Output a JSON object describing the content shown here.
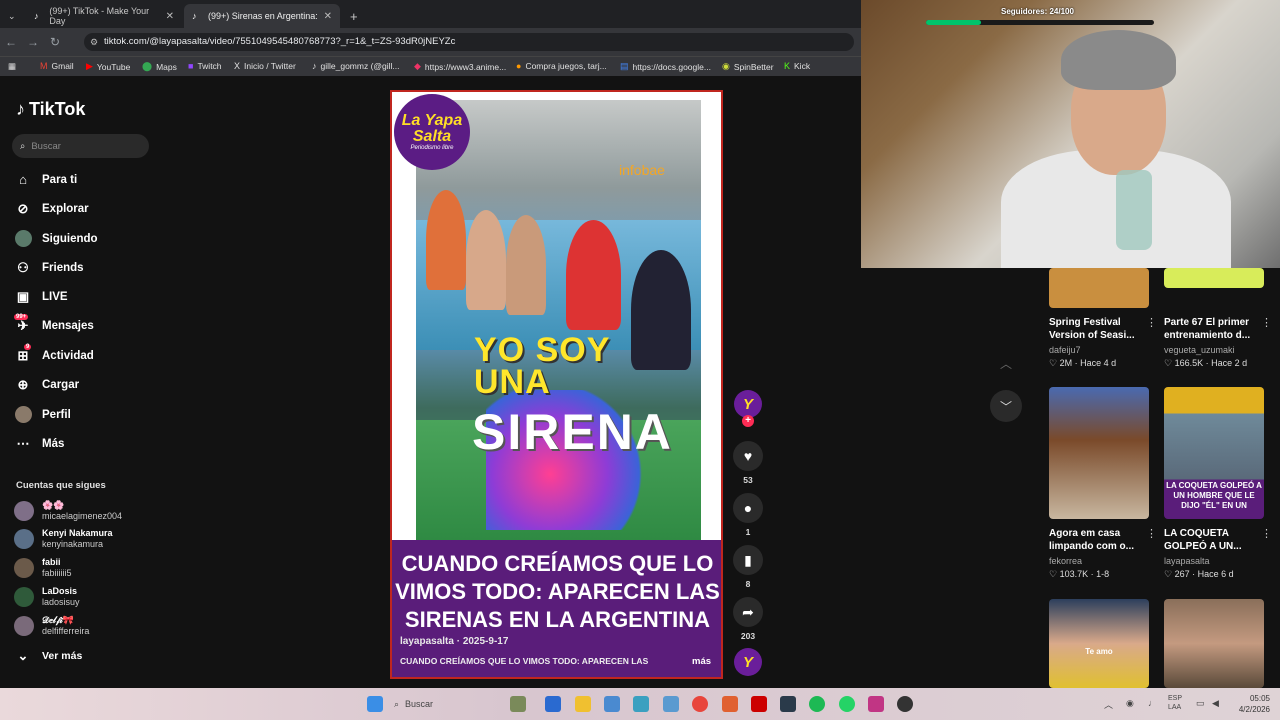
{
  "browser": {
    "tabs": [
      {
        "label": "(99+) TikTok - Make Your Day",
        "active": false
      },
      {
        "label": "(99+) Sirenas en Argentina: Un ...",
        "active": true
      }
    ],
    "new_tab": "+",
    "url": "tiktok.com/@layapasalta/video/7551049545480768773?_r=1&_t=ZS-93dR0jNEYZc",
    "bookmarks": [
      {
        "label": "Gmail",
        "icon": "gmail-icon"
      },
      {
        "label": "YouTube",
        "icon": "youtube-icon"
      },
      {
        "label": "Maps",
        "icon": "maps-icon"
      },
      {
        "label": "Twitch",
        "icon": "twitch-icon"
      },
      {
        "label": "Inicio / Twitter",
        "icon": "x-icon"
      },
      {
        "label": "gille_gommz (@gill...",
        "icon": "tiktok-icon"
      },
      {
        "label": "https://www3.anime...",
        "icon": "anime-icon"
      },
      {
        "label": "Compra juegos, tarj...",
        "icon": "store-icon"
      },
      {
        "label": "https://docs.google...",
        "icon": "docs-icon"
      },
      {
        "label": "SpinBetter",
        "icon": "spin-icon"
      },
      {
        "label": "Kick",
        "icon": "kick-icon"
      }
    ]
  },
  "sidebar": {
    "brand": "TikTok",
    "search_placeholder": "Buscar",
    "nav": [
      {
        "label": "Para ti",
        "icon": "home-icon"
      },
      {
        "label": "Explorar",
        "icon": "compass-icon"
      },
      {
        "label": "Siguiendo",
        "icon": "following-avatar-icon"
      },
      {
        "label": "Friends",
        "icon": "friends-icon"
      },
      {
        "label": "LIVE",
        "icon": "live-icon"
      },
      {
        "label": "Mensajes",
        "icon": "messages-icon",
        "badge": "99+"
      },
      {
        "label": "Actividad",
        "icon": "activity-icon",
        "badge": "9"
      },
      {
        "label": "Cargar",
        "icon": "upload-icon"
      },
      {
        "label": "Perfil",
        "icon": "profile-icon"
      },
      {
        "label": "Más",
        "icon": "more-icon"
      }
    ],
    "following_header": "Cuentas que sigues",
    "accounts": [
      {
        "name": "🌸🌸",
        "handle": "micaelagimenez004"
      },
      {
        "name": "Kenyi Nakamura",
        "handle": "kenyinakamura"
      },
      {
        "name": "fabii",
        "handle": "fabiiiiii5"
      },
      {
        "name": "LaDosis",
        "handle": "ladosisuy"
      },
      {
        "name": "𝒟𝑒𝓁𝒻𝒾🎀",
        "handle": "delfifferreira"
      }
    ],
    "see_more": "Ver más"
  },
  "video": {
    "channel_logo_line1": "La Yapa",
    "channel_logo_line2": "Salta",
    "channel_logo_tag": "Periodismo libre",
    "watermark": "infobae",
    "overlay_line1": "YO SOY",
    "overlay_line2": "UNA",
    "overlay_big": "SIRENA",
    "headline": "CUANDO CREÍAMOS QUE LO VIMOS TODO: APARECEN LAS SIRENAS EN LA ARGENTINA",
    "author": "layapasalta · 2025-9-17",
    "description": "CUANDO CREÍAMOS QUE LO VIMOS TODO: APARECEN LAS",
    "more": "más"
  },
  "actions": {
    "likes": "53",
    "comments": "1",
    "saves": "8",
    "shares": "203"
  },
  "stream_overlay": {
    "followers_label": "Seguidores: 24/100",
    "followers_progress": 0.24
  },
  "recommendations": [
    {
      "title": "Spring Festival",
      "title2": "Version of Seasi...",
      "user": "dafeiju7",
      "stats": "♡ 2M · Hace 4 d",
      "thumb_color": "#c98f3f"
    },
    {
      "title": "Parte 67 El primer",
      "title2": "entrenamiento d...",
      "user": "vegueta_uzumaki",
      "stats": "♡ 166.5K · Hace 2 d",
      "thumb_color": "#d8ec5a"
    },
    {
      "title": "Agora em casa",
      "title2": "limpando com o...",
      "user": "fekorrea",
      "stats": "♡ 103.7K · 1-8",
      "thumb_color": "#7a4a2a"
    },
    {
      "title": "LA COQUETA",
      "title2": "GOLPEÓ A UN...",
      "user": "layapasalta",
      "stats": "♡ 267 · Hace 6 d",
      "thumb_color": "#5a1d7a",
      "thumb_caption": "LA COQUETA GOLPEÓ A UN HOMBRE QUE LE DIJO \"ÉL\" EN UN"
    },
    {
      "title": "",
      "title2": "",
      "user": "",
      "stats": "",
      "thumb_color": "#2c3f5c",
      "thumb_caption": "Te amo"
    },
    {
      "title": "",
      "title2": "",
      "user": "",
      "stats": "",
      "thumb_color": "#8a6f5a"
    }
  ],
  "taskbar": {
    "search": "Buscar",
    "lang": "ESP\nLAA",
    "time": "05:05",
    "date": "4/2/2026"
  }
}
